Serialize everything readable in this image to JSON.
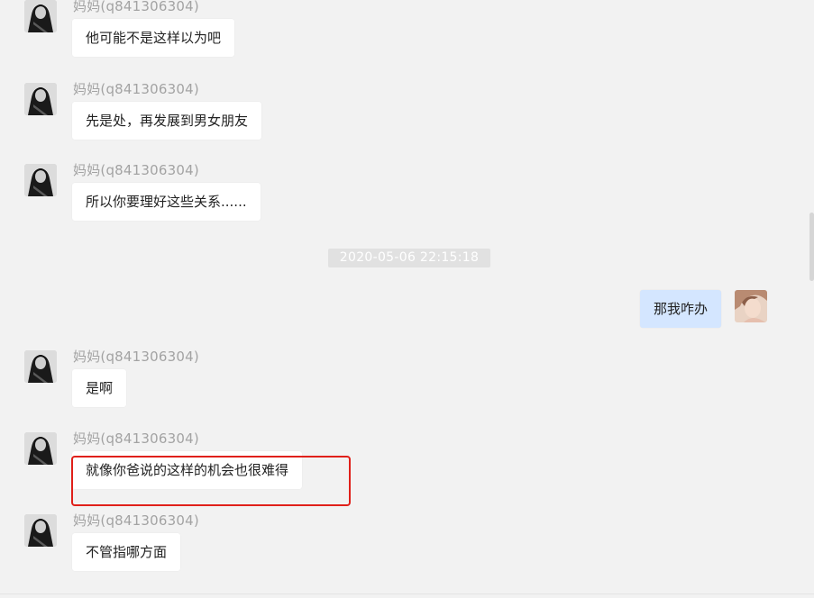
{
  "messages": [
    {
      "sender": "妈妈(q841306304)",
      "text": "他可能不是这样以为吧"
    },
    {
      "sender": "妈妈(q841306304)",
      "text": "先是处，再发展到男女朋友"
    },
    {
      "sender": "妈妈(q841306304)",
      "text": "所以你要理好这些关系......"
    },
    {
      "sender": "妈妈(q841306304)",
      "text": "是啊"
    },
    {
      "sender": "妈妈(q841306304)",
      "text": "就像你爸说的这样的机会也很难得"
    },
    {
      "sender": "妈妈(q841306304)",
      "text": "不管指哪方面"
    }
  ],
  "timestamp": "2020-05-06 22:15:18",
  "my_message": {
    "text": "那我咋办"
  },
  "colors": {
    "background": "#f2f2f2",
    "bubble_incoming": "#ffffff",
    "bubble_outgoing": "#d4e6ff",
    "highlight_border": "#e0201a",
    "sender_text": "#a3a3a3"
  }
}
